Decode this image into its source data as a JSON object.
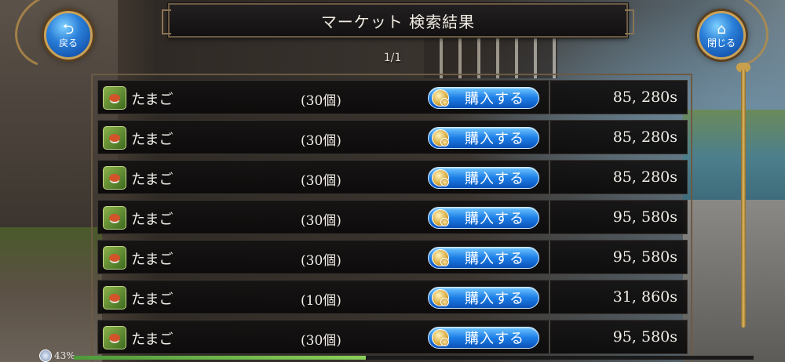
{
  "header": {
    "title": "マーケット 検索結果",
    "back_label": "戻る",
    "close_label": "閉じる",
    "back_icon": "return-arrow-icon",
    "close_icon": "home-icon"
  },
  "pagination": {
    "label": "1/1"
  },
  "listings": [
    {
      "name": "たまご",
      "quantity": "(30個)",
      "buy_label": "購入する",
      "price": "85, 280s"
    },
    {
      "name": "たまご",
      "quantity": "(30個)",
      "buy_label": "購入する",
      "price": "85, 280s"
    },
    {
      "name": "たまご",
      "quantity": "(30個)",
      "buy_label": "購入する",
      "price": "85, 280s"
    },
    {
      "name": "たまご",
      "quantity": "(30個)",
      "buy_label": "購入する",
      "price": "95, 580s"
    },
    {
      "name": "たまご",
      "quantity": "(30個)",
      "buy_label": "購入する",
      "price": "95, 580s"
    },
    {
      "name": "たまご",
      "quantity": "(10個)",
      "buy_label": "購入する",
      "price": "31, 860s"
    },
    {
      "name": "たまご",
      "quantity": "(30個)",
      "buy_label": "購入する",
      "price": "95, 580s"
    }
  ],
  "status": {
    "percent_label": "43%",
    "progress": 0.43
  },
  "colors": {
    "accent_gold": "#c9a259",
    "button_blue": "#1d7ee6",
    "panel_dark": "#141212"
  }
}
